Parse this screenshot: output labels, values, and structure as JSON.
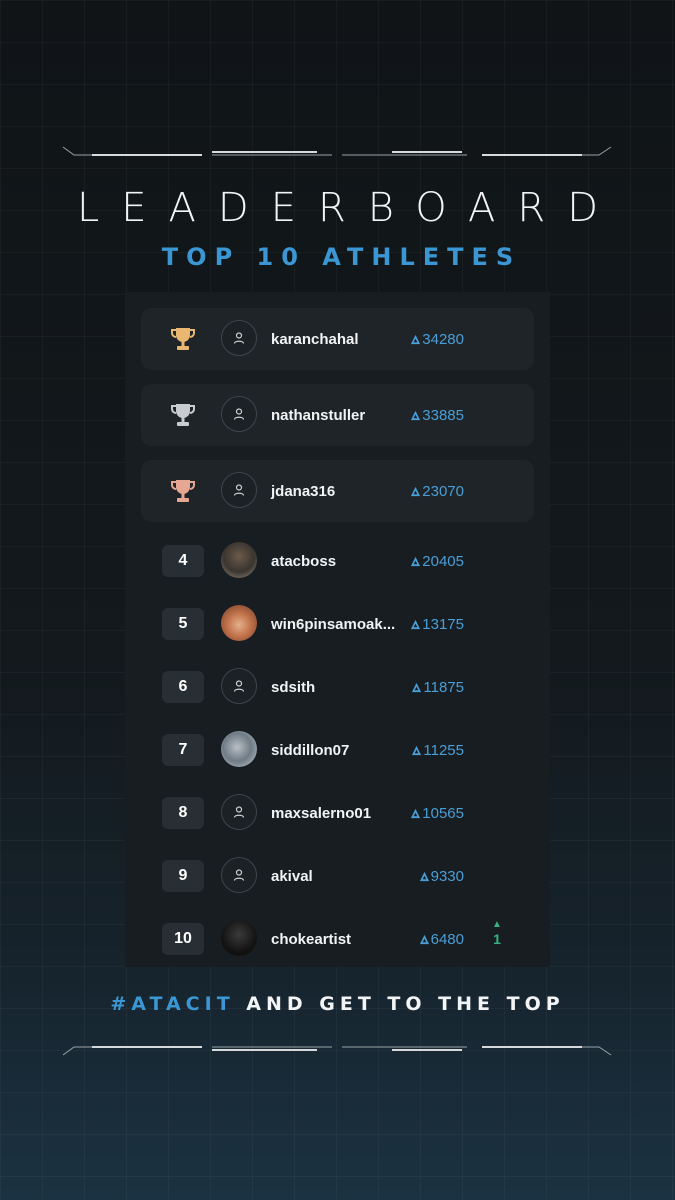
{
  "header": {
    "title": "LEADERBOARD",
    "subtitle": "TOP 10 ATHLETES"
  },
  "leaderboard": {
    "top": [
      {
        "trophy": "gold-trophy-icon",
        "username": "karanchahal",
        "score": "34280"
      },
      {
        "trophy": "silver-trophy-icon",
        "username": "nathanstuller",
        "score": "33885"
      },
      {
        "trophy": "bronze-trophy-icon",
        "username": "jdana316",
        "score": "23070"
      }
    ],
    "rest": [
      {
        "rank": "4",
        "username": "atacboss",
        "score": "20405",
        "avatar": "photo"
      },
      {
        "rank": "5",
        "username": "win6pinsamoak...",
        "score": "13175",
        "avatar": "photo"
      },
      {
        "rank": "6",
        "username": "sdsith",
        "score": "11875",
        "avatar": "default"
      },
      {
        "rank": "7",
        "username": "siddillon07",
        "score": "11255",
        "avatar": "photo"
      },
      {
        "rank": "8",
        "username": "maxsalerno01",
        "score": "10565",
        "avatar": "default"
      },
      {
        "rank": "9",
        "username": "akival",
        "score": "9330",
        "avatar": "default"
      },
      {
        "rank": "10",
        "username": "chokeartist",
        "score": "6480",
        "avatar": "photo",
        "trend": "1"
      }
    ]
  },
  "footer": {
    "hashtag": "#ATACIT",
    "text": " AND GET TO THE TOP"
  },
  "colors": {
    "accent": "#3b97d3",
    "gold": "#e9b770",
    "silver": "#c8ccd0",
    "bronze": "#e6a792",
    "trend_up": "#36b37e"
  }
}
